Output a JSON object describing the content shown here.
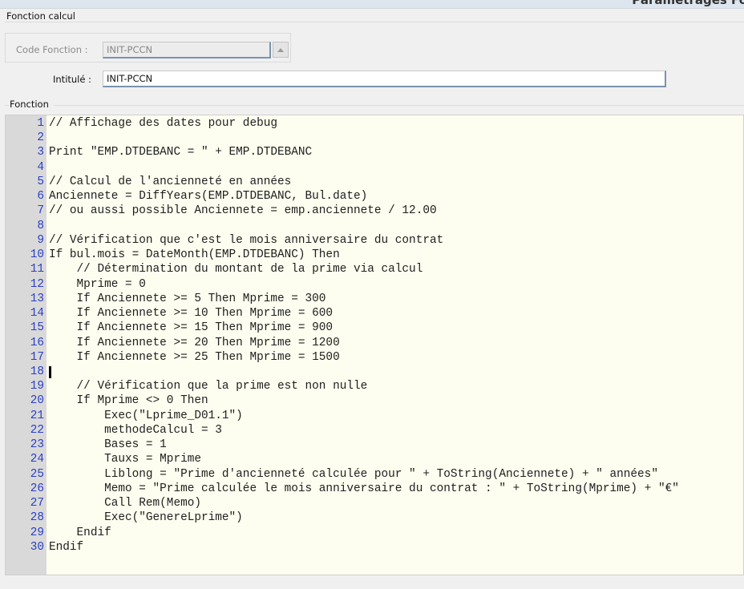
{
  "window": {
    "title": "Paramétrages Fo"
  },
  "group_calcul": {
    "label": "Fonction calcul"
  },
  "code_fonction": {
    "label": "Code Fonction :",
    "value": "INIT-PCCN"
  },
  "intitule": {
    "label": "Intitulé :",
    "value": "INIT-PCCN"
  },
  "group_fonction": {
    "label": "Fonction"
  },
  "editor": {
    "caret_line": 18,
    "lines": [
      "// Affichage des dates pour debug",
      "",
      "Print \"EMP.DTDEBANC = \" + EMP.DTDEBANC",
      "",
      "// Calcul de l'ancienneté en années",
      "Anciennete = DiffYears(EMP.DTDEBANC, Bul.date)",
      "// ou aussi possible Anciennete = emp.anciennete / 12.00",
      "",
      "// Vérification que c'est le mois anniversaire du contrat",
      "If bul.mois = DateMonth(EMP.DTDEBANC) Then",
      "    // Détermination du montant de la prime via calcul",
      "    Mprime = 0",
      "    If Anciennete >= 5 Then Mprime = 300",
      "    If Anciennete >= 10 Then Mprime = 600",
      "    If Anciennete >= 15 Then Mprime = 900",
      "    If Anciennete >= 20 Then Mprime = 1200",
      "    If Anciennete >= 25 Then Mprime = 1500",
      "",
      "    // Vérification que la prime est non nulle",
      "    If Mprime <> 0 Then",
      "        Exec(\"Lprime_D01.1\")",
      "        methodeCalcul = 3",
      "        Bases = 1",
      "        Tauxs = Mprime",
      "        Liblong = \"Prime d'ancienneté calculée pour \" + ToString(Anciennete) + \" années\"",
      "        Memo = \"Prime calculée le mois anniversaire du contrat : \" + ToString(Mprime) + \"€\"",
      "        Call Rem(Memo)",
      "        Exec(\"GenereLprime\")",
      "    Endif",
      "Endif"
    ]
  }
}
